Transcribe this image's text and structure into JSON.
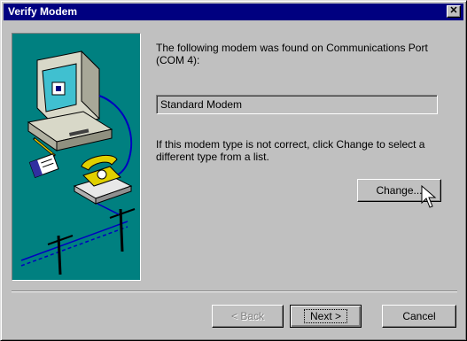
{
  "window": {
    "title": "Verify Modem",
    "close_symbol": "✕"
  },
  "content": {
    "found_text": "The following modem was found on Communications Port (COM 4):",
    "modem_name": "Standard Modem",
    "hint_text": "If this modem type is not correct, click Change to select a different type from a list."
  },
  "buttons": {
    "change": "Change...",
    "back": "< Back",
    "next": "Next >",
    "cancel": "Cancel"
  },
  "icons": [
    "close-icon",
    "computer-illustration",
    "telephone-modem-illustration",
    "phone-line-illustration",
    "mouse-pointer-icon"
  ],
  "colors": {
    "title_bar": "#000080",
    "dialog_face": "#c0c0c0",
    "illustration_background": "#008080"
  }
}
